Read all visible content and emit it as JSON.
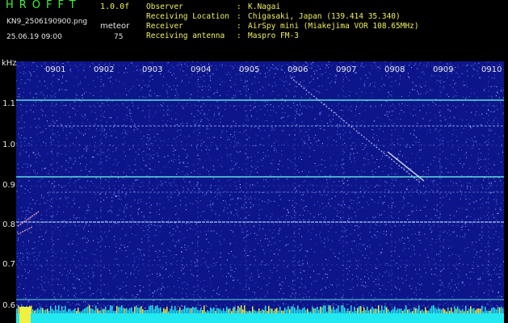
{
  "header": {
    "title": "HROFFT",
    "version": "1.0.0f",
    "filename": "KN9_2506190900.png",
    "mode": "meteor",
    "datetime": "25.06.19 09:00",
    "level": "75"
  },
  "info": [
    {
      "key": "Observer",
      "value": "K.Nagai"
    },
    {
      "key": "Receiving Location",
      "value": "Chigasaki, Japan (139.414 35.340)"
    },
    {
      "key": "Receiver",
      "value": "AirSpy mini (Miakejima VOR 108.65MHz)"
    },
    {
      "key": "Receiving antenna",
      "value": "Maspro FM-3"
    }
  ],
  "axes": {
    "y_unit": "kHz",
    "y_ticks": [
      "1.1",
      "1.0",
      "0.9",
      "0.8",
      "0.7",
      "0.6"
    ],
    "x_ticks": [
      "0901",
      "0902",
      "0903",
      "0904",
      "0905",
      "0906",
      "0907",
      "0908",
      "0909",
      "0910"
    ]
  },
  "colors": {
    "background": "#000000",
    "spectrogram_bg": "#0d158a",
    "carrier_line": "#59e0d8",
    "label_green": "#3cf040",
    "label_yellow": "#f0f060"
  }
}
